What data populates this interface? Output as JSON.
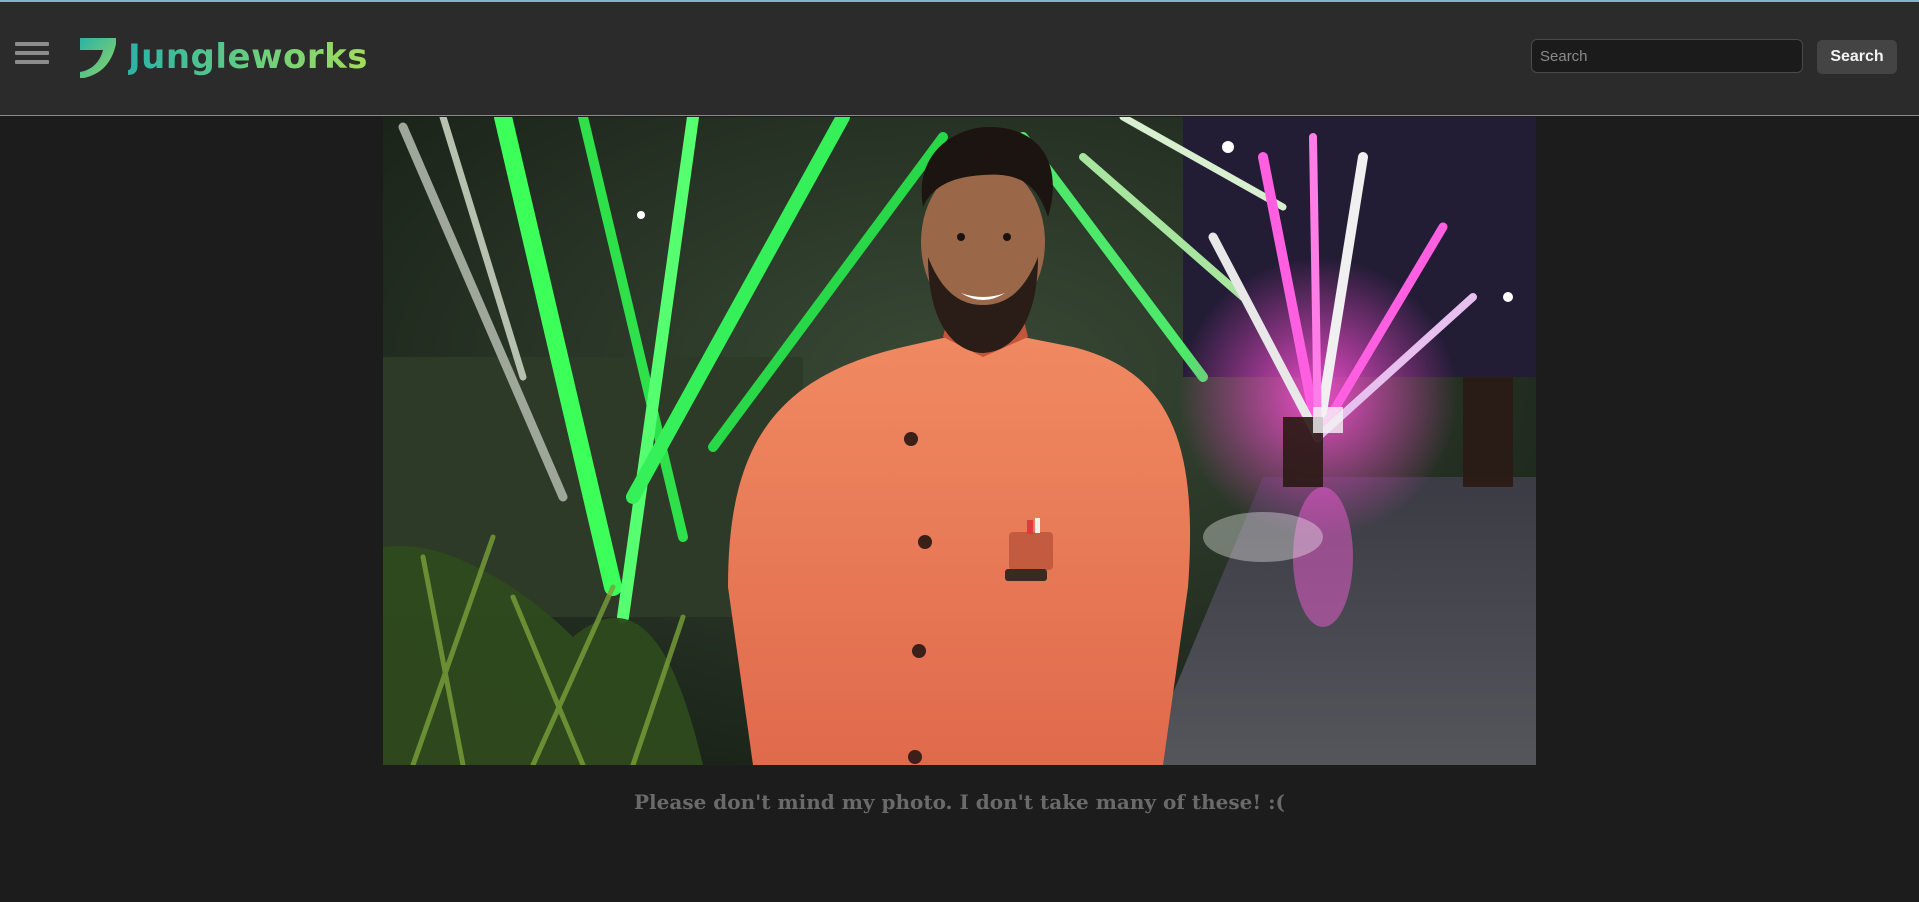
{
  "header": {
    "brand": "Jungleworks",
    "search": {
      "placeholder": "Search",
      "value": "",
      "button_label": "Search"
    }
  },
  "main": {
    "caption": "Please don't mind my photo. I don't take many of these! :("
  },
  "colors": {
    "accent_line": "#7fb8c4",
    "brand_gradient_start": "#2bb3a6",
    "brand_gradient_end": "#a3dc5b",
    "header_bg": "#2b2b2b",
    "page_bg": "#1c1c1c"
  },
  "icons": {
    "menu": "hamburger-menu-icon",
    "logo": "jungleworks-logo-icon"
  }
}
